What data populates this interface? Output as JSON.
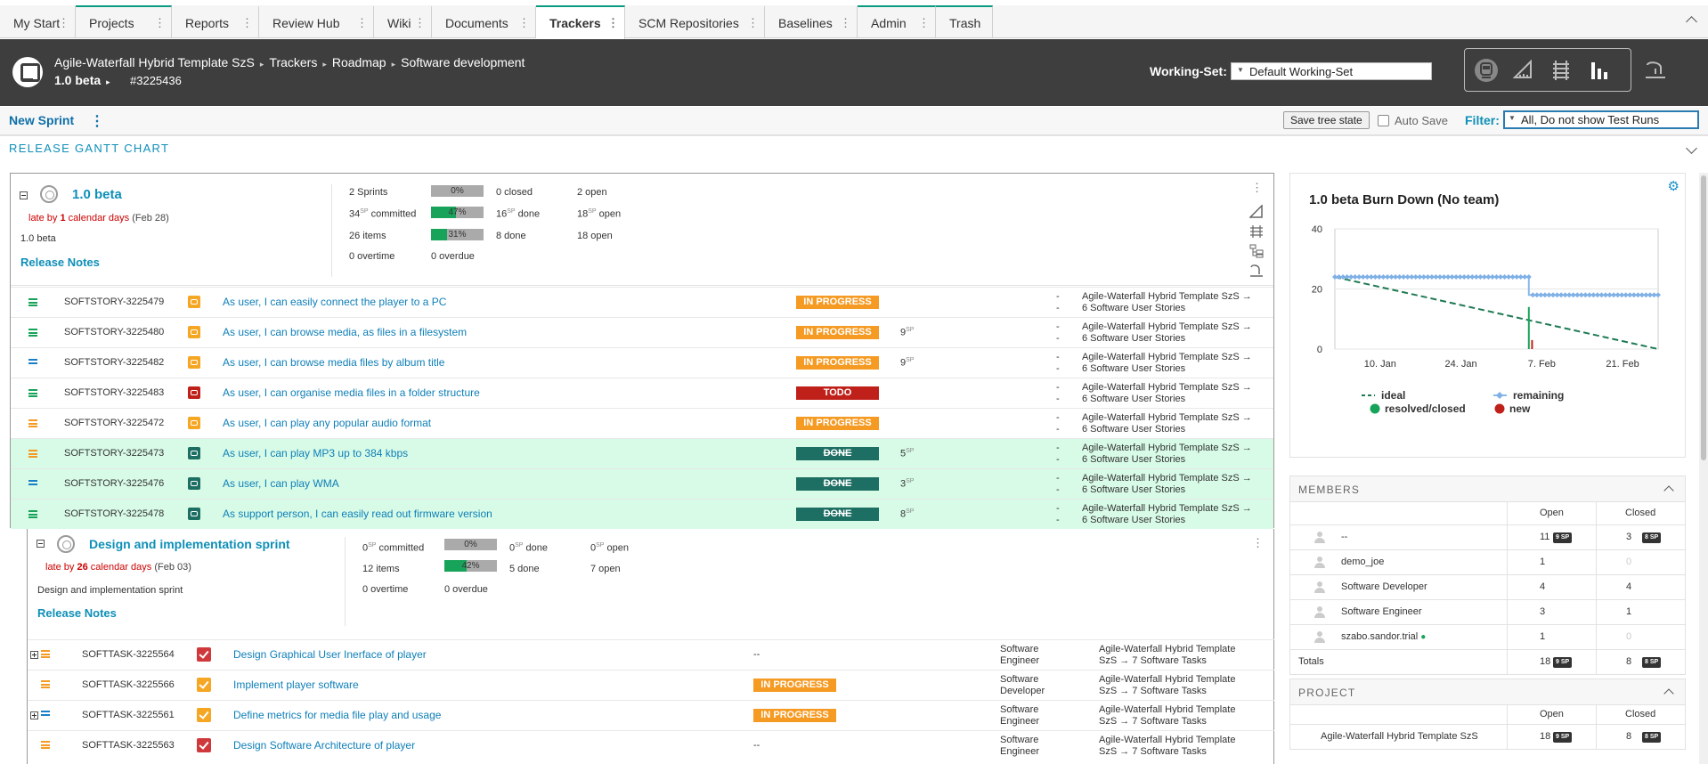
{
  "tabs": [
    {
      "label": "My Start"
    },
    {
      "label": "Projects"
    },
    {
      "label": "Reports"
    },
    {
      "label": "Review Hub"
    },
    {
      "label": "Wiki"
    },
    {
      "label": "Documents"
    },
    {
      "label": "Trackers"
    },
    {
      "label": "SCM Repositories"
    },
    {
      "label": "Baselines"
    },
    {
      "label": "Admin"
    },
    {
      "label": "Trash"
    }
  ],
  "tab_menu_glyph": "⋮",
  "header": {
    "breadcrumb": [
      "Agile-Waterfall Hybrid Template SzS",
      "Trackers",
      "Roadmap",
      "Software development"
    ],
    "sep": "▸",
    "version": "1.0 beta",
    "version_arrow": "▸",
    "item_id": "#3225436",
    "working_set_label": "Working-Set:",
    "working_set_value": "Default Working-Set",
    "icons": [
      "train-icon",
      "ruler-icon",
      "tracks-icon",
      "bar-chart-icon",
      "station-icon"
    ]
  },
  "toolbar": {
    "new_sprint": "New Sprint",
    "menu": "⋮",
    "save_tree_state": "Save tree state",
    "auto_save": "Auto Save",
    "filter_label": "Filter:",
    "filter_value": "All, Do not show Test Runs"
  },
  "section_title": "RELEASE GANTT CHART",
  "release": {
    "title": "1.0 beta",
    "late_prefix": "late by",
    "late_days": "1",
    "late_suffix": "calendar days",
    "late_date": "(Feb 28)",
    "description": "1.0 beta",
    "release_notes": "Release Notes",
    "stats": {
      "sprints": "2 Sprints",
      "sprints_pct": "0%",
      "sprints_pct_value": 0,
      "closed": "0 closed",
      "open": "2 open",
      "committed": "34",
      "committed_suffix": " committed",
      "committed_pct": "47%",
      "committed_pct_value": 47,
      "sp_done": "16",
      "sp_done_suffix": " done",
      "sp_open": "18",
      "sp_open_suffix": " open",
      "items": "26 items",
      "items_pct": "31%",
      "items_pct_value": 31,
      "items_done": "8 done",
      "items_open": "18 open",
      "overtime": "0 overtime",
      "overdue": "0 overdue"
    },
    "sp_unit": "SP",
    "rows": [
      {
        "id": "SOFTSTORY-3225479",
        "title": "As user, I can easily connect the player to a PC",
        "status": "IN PROGRESS",
        "sp": "",
        "dash": "-",
        "tracker": "Agile-Waterfall Hybrid Template SzS →",
        "tracker2": "6 Software User Stories",
        "done": false,
        "prio_color": "#18a35a",
        "icon_color": "#f5a623"
      },
      {
        "id": "SOFTSTORY-3225480",
        "title": "As user, I can browse media, as files in a filesystem",
        "status": "IN PROGRESS",
        "sp": "9",
        "dash": "-",
        "tracker": "Agile-Waterfall Hybrid Template SzS →",
        "tracker2": "6 Software User Stories",
        "done": false,
        "prio_color": "#18a35a",
        "icon_color": "#f5a623"
      },
      {
        "id": "SOFTSTORY-3225482",
        "title": "As user, I can browse media files by album title",
        "status": "IN PROGRESS",
        "sp": "9",
        "dash": "-",
        "tracker": "Agile-Waterfall Hybrid Template SzS →",
        "tracker2": "6 Software User Stories",
        "done": false,
        "prio_color": "#1a7fc8",
        "icon_color": "#f5a623"
      },
      {
        "id": "SOFTSTORY-3225483",
        "title": "As user, I can organise media files in a folder structure",
        "status": "TODO",
        "sp": "",
        "dash": "-",
        "tracker": "Agile-Waterfall Hybrid Template SzS →",
        "tracker2": "6 Software User Stories",
        "done": false,
        "prio_color": "#18a35a",
        "icon_color": "#c0201a"
      },
      {
        "id": "SOFTSTORY-3225472",
        "title": "As user, I can play any popular audio format",
        "status": "IN PROGRESS",
        "sp": "",
        "dash": "-",
        "tracker": "Agile-Waterfall Hybrid Template SzS →",
        "tracker2": "6 Software User Stories",
        "done": false,
        "prio_color": "#f59a23",
        "icon_color": "#f5a623"
      },
      {
        "id": "SOFTSTORY-3225473",
        "title": "As user, I can play MP3 up to 384 kbps",
        "status": "DONE",
        "sp": "5",
        "dash": "-",
        "tracker": "Agile-Waterfall Hybrid Template SzS →",
        "tracker2": "6 Software User Stories",
        "done": true,
        "prio_color": "#f59a23",
        "icon_color": "#1d6e63"
      },
      {
        "id": "SOFTSTORY-3225476",
        "title": "As user, I can play WMA",
        "status": "DONE",
        "sp": "3",
        "dash": "-",
        "tracker": "Agile-Waterfall Hybrid Template SzS →",
        "tracker2": "6 Software User Stories",
        "done": true,
        "prio_color": "#1a7fc8",
        "icon_color": "#1d6e63"
      },
      {
        "id": "SOFTSTORY-3225478",
        "title": "As support person, I can easily read out firmware version",
        "status": "DONE",
        "sp": "8",
        "dash": "-",
        "tracker": "Agile-Waterfall Hybrid Template SzS →",
        "tracker2": "6 Software User Stories",
        "done": true,
        "prio_color": "#18a35a",
        "icon_color": "#1d6e63"
      }
    ]
  },
  "sprint": {
    "title": "Design and implementation sprint",
    "late_prefix": "late by",
    "late_days": "26",
    "late_suffix": "calendar days",
    "late_date": "(Feb 03)",
    "description": "Design and implementation sprint",
    "release_notes": "Release Notes",
    "stats": {
      "committed": "0",
      "committed_suffix": " committed",
      "committed_pct": "0%",
      "committed_pct_value": 0,
      "sp_done": "0",
      "sp_done_suffix": " done",
      "sp_open": "0",
      "sp_open_suffix": " open",
      "items": "12 items",
      "items_pct": "42%",
      "items_pct_value": 42,
      "items_done": "5 done",
      "items_open": "7 open",
      "overtime": "0 overtime",
      "overdue": "0 overdue"
    },
    "tasks": [
      {
        "id": "SOFTTASK-3225564",
        "title": "Design Graphical User Inerface of player",
        "status": "--",
        "assignee": "Software",
        "assignee2": "Engineer",
        "tracker": "Agile-Waterfall Hybrid Template",
        "tracker2": "SzS → 7 Software Tasks",
        "expand": true,
        "prio_color": "#f59a23",
        "cb_color": "#d0393b"
      },
      {
        "id": "SOFTTASK-3225566",
        "title": "Implement player software",
        "status": "IN PROGRESS",
        "assignee": "Software",
        "assignee2": "Developer",
        "tracker": "Agile-Waterfall Hybrid Template",
        "tracker2": "SzS → 7 Software Tasks",
        "expand": false,
        "prio_color": "#f59a23",
        "cb_color": "#f5a623"
      },
      {
        "id": "SOFTTASK-3225561",
        "title": "Define metrics for media file play and usage",
        "status": "IN PROGRESS",
        "assignee": "Software",
        "assignee2": "Engineer",
        "tracker": "Agile-Waterfall Hybrid Template",
        "tracker2": "SzS → 7 Software Tasks",
        "expand": true,
        "prio_color": "#1a7fc8",
        "cb_color": "#f5a623"
      },
      {
        "id": "SOFTTASK-3225563",
        "title": "Design Software Architecture of player",
        "status": "--",
        "assignee": "Software",
        "assignee2": "Engineer",
        "tracker": "Agile-Waterfall Hybrid Template",
        "tracker2": "SzS → 7 Software Tasks",
        "expand": false,
        "prio_color": "#f59a23",
        "cb_color": "#d0393b"
      }
    ]
  },
  "colors": {
    "in_progress": "#f59a23",
    "todo": "#c0201a",
    "done": "#1d6e63",
    "accent": "#0e8fb8"
  },
  "chart_data": {
    "type": "line",
    "title": "1.0 beta Burn Down (No team)",
    "xlabel": "",
    "ylabel": "",
    "ylim": [
      0,
      40
    ],
    "yticks": [
      "0",
      "20",
      "40"
    ],
    "xticks": [
      "10. Jan",
      "24. Jan",
      "7. Feb",
      "21. Feb"
    ],
    "xtick_pos": [
      0.14,
      0.39,
      0.64,
      0.89
    ],
    "grid": true,
    "legend_position": "bottom",
    "series": [
      {
        "name": "ideal",
        "x": [
          0,
          1
        ],
        "values": [
          24,
          0
        ]
      },
      {
        "name": "remaining",
        "x": [
          0,
          0.6,
          0.6,
          1
        ],
        "values": [
          24,
          24,
          18,
          18
        ]
      },
      {
        "name": "resolved/closed",
        "x": [
          0.6
        ],
        "values": [
          14
        ]
      },
      {
        "name": "new",
        "x": [
          0.61
        ],
        "values": [
          3
        ]
      }
    ]
  },
  "members": {
    "title": "MEMBERS",
    "col_open": "Open",
    "col_closed": "Closed",
    "sp_unit": "SP",
    "rows": [
      {
        "name": "--",
        "open": "11",
        "open_sp": "9",
        "closed": "3",
        "closed_sp": "8",
        "online": false
      },
      {
        "name": "demo_joe",
        "open": "1",
        "open_sp": "",
        "closed": "0",
        "closed_sp": "",
        "online": false
      },
      {
        "name": "Software Developer",
        "open": "4",
        "open_sp": "",
        "closed": "4",
        "closed_sp": "",
        "online": false
      },
      {
        "name": "Software Engineer",
        "open": "3",
        "open_sp": "",
        "closed": "1",
        "closed_sp": "",
        "online": false
      },
      {
        "name": "szabo.sandor.trial",
        "open": "1",
        "open_sp": "",
        "closed": "0",
        "closed_sp": "",
        "online": true
      }
    ],
    "totals_label": "Totals",
    "totals_open": "18",
    "totals_open_sp": "9",
    "totals_closed": "8",
    "totals_closed_sp": "8"
  },
  "project": {
    "title": "PROJECT",
    "col_open": "Open",
    "col_closed": "Closed",
    "name": "Agile-Waterfall Hybrid Template SzS",
    "open": "18",
    "open_sp": "9",
    "closed": "8",
    "closed_sp": "8"
  }
}
